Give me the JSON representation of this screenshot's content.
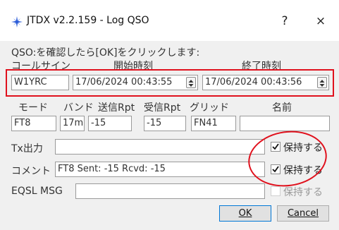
{
  "titlebar": {
    "title": "JTDX v2.2.159 - Log QSO",
    "help_label": "?",
    "close_label": "×",
    "icon": "jtdx-star-icon"
  },
  "instruction": "QSO:を確認したら[OK]をクリックします:",
  "headers": {
    "callsign": "コールサイン",
    "start_time": "開始時刻",
    "end_time": "終了時刻"
  },
  "fields": {
    "callsign": "W1YRC",
    "start_datetime": "17/06/2024 00:43:55",
    "end_datetime": "17/06/2024 00:43:56"
  },
  "row2_headers": {
    "mode": "モード",
    "band": "バンド",
    "sent_rpt": "送信Rpt",
    "rcvd_rpt": "受信Rpt",
    "grid": "グリッド",
    "name": "名前"
  },
  "row2_values": {
    "mode": "FT8",
    "band": "17m",
    "sent_rpt": "-15",
    "rcvd_rpt": "-15",
    "grid": "FN41",
    "name": ""
  },
  "tx_power": {
    "label": "Tx出力",
    "value": "",
    "keep_label": "保持する",
    "keep_checked": true
  },
  "comment": {
    "label": "コメント",
    "value": "FT8  Sent: -15  Rcvd: -15",
    "keep_label": "保持する",
    "keep_checked": true
  },
  "eqsl": {
    "label": "EQSL MSG",
    "value": "",
    "keep_label": "保持する",
    "keep_checked": false
  },
  "buttons": {
    "ok_label": "OK",
    "cancel_label": "Cancel"
  },
  "colors": {
    "annotation_red": "#e0111d",
    "default_button_border": "#0078d7"
  }
}
